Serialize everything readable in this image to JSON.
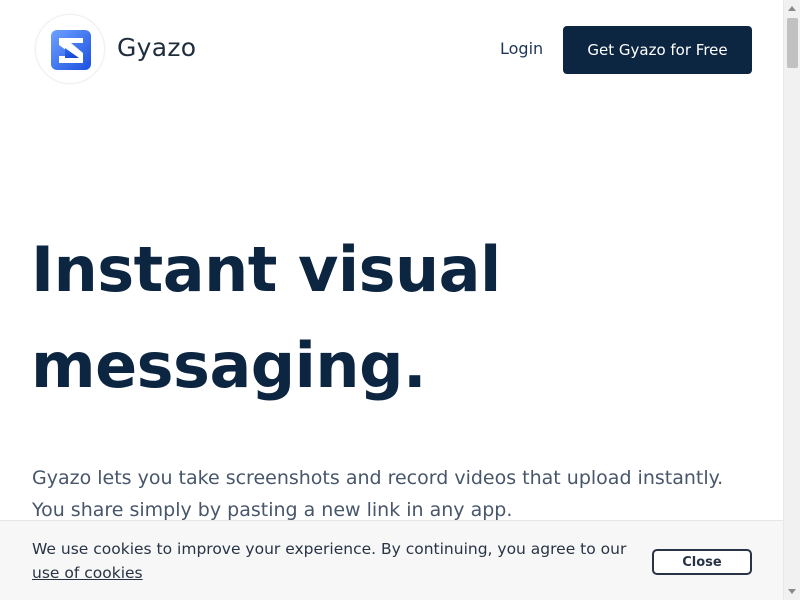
{
  "header": {
    "brand_name": "Gyazo",
    "logo_icon": "gyazo-logo-icon",
    "login_label": "Login",
    "cta_label": "Get Gyazo for Free"
  },
  "hero": {
    "title": "Instant visual messaging.",
    "subtitle": "Gyazo lets you take screenshots and record videos that upload instantly. You share simply by pasting a new link in any app."
  },
  "cookie_banner": {
    "text": "We use cookies to improve your experience. By continuing, you agree to our",
    "link_label": "use of cookies",
    "close_label": "Close"
  },
  "colors": {
    "navy": "#0c2540",
    "logo_blue_dark": "#1b4fd8",
    "logo_blue_light": "#5b8ff5",
    "body_text": "#47566a",
    "cookie_bg": "#f7f7f7"
  }
}
